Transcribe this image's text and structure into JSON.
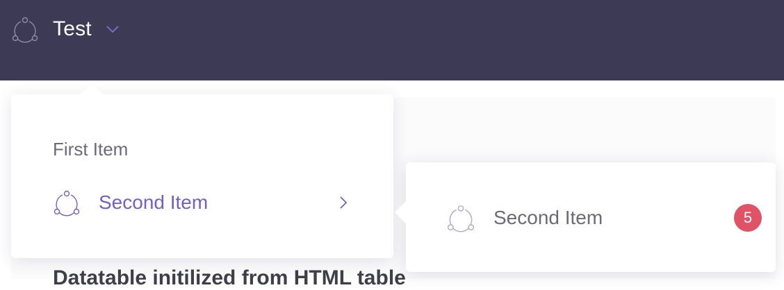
{
  "header": {
    "title": "Test",
    "logo_icon": "nodes-icon",
    "caret_icon": "chevron-down-icon",
    "background": "#3d3a55"
  },
  "menu": {
    "items": [
      {
        "label": "First Item"
      },
      {
        "label": "Second Item",
        "icon": "nodes-icon",
        "chevron": "chevron-right-icon",
        "active": true
      }
    ]
  },
  "submenu": {
    "items": [
      {
        "label": "Second Item",
        "icon": "nodes-icon",
        "badge": "5"
      }
    ]
  },
  "content": {
    "heading": "Datatable initilized from HTML table"
  },
  "colors": {
    "accent": "#6f62c4",
    "badge": "#e05367",
    "text": "#6b6b78"
  }
}
